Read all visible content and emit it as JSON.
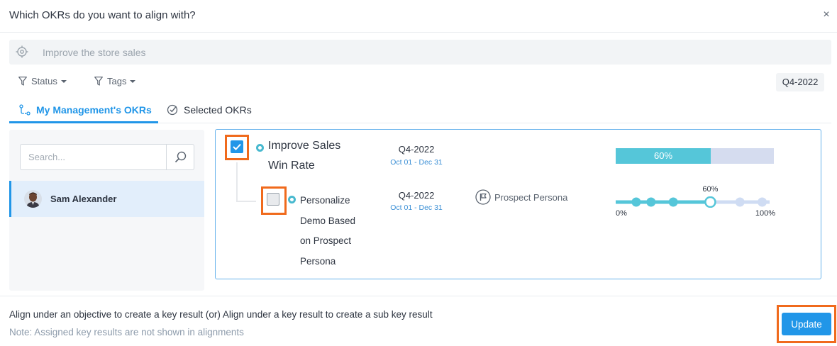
{
  "header": {
    "title": "Which OKRs do you want to align with?",
    "close_label": "×"
  },
  "search": {
    "text": "Improve the store sales"
  },
  "filters": {
    "status_label": "Status",
    "tags_label": "Tags",
    "quarter": "Q4-2022"
  },
  "tabs": [
    {
      "label": "My Management's OKRs",
      "active": true
    },
    {
      "label": "Selected OKRs",
      "active": false
    }
  ],
  "left_panel": {
    "search_placeholder": "Search...",
    "users": [
      {
        "name": "Sam Alexander",
        "selected": true
      }
    ]
  },
  "okrs": {
    "objective": {
      "title_line1": "Improve Sales",
      "title_line2": "Win Rate",
      "quarter": "Q4-2022",
      "date_range": "Oct 01 - Dec 31",
      "progress": 60,
      "progress_label": "60%",
      "checked": true
    },
    "key_result": {
      "title_lines": [
        "Personalize",
        "Demo Based",
        "on Prospect",
        "Persona"
      ],
      "quarter": "Q4-2022",
      "date_range": "Oct 01 - Dec 31",
      "tag": "Prospect Persona",
      "progress": 60,
      "progress_label": "60%",
      "axis_min": "0%",
      "axis_max": "100%",
      "checked": false
    }
  },
  "footer": {
    "main_text": "Align under an objective to create a key result (or) Align under a key result to create a sub key result",
    "note_text": "Note: Assigned key results are not shown in alignments",
    "update_label": "Update"
  },
  "colors": {
    "accent": "#2196e8",
    "progress": "#55c6d9",
    "highlight": "#f06a1c"
  }
}
